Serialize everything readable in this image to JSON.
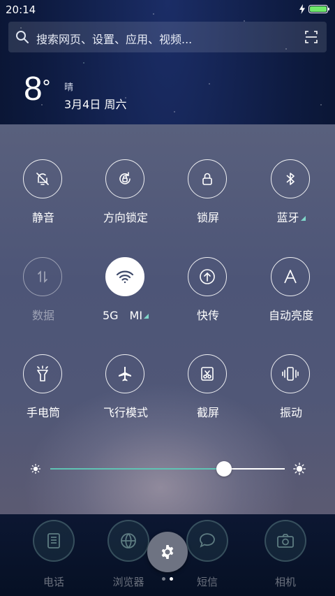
{
  "status_bar": {
    "time": "20:14",
    "battery_color": "#6fe86a"
  },
  "search": {
    "placeholder": "搜索网页、设置、应用、视频..."
  },
  "weather": {
    "temperature": "8",
    "unit": "°",
    "condition": "晴",
    "date": "3月4日 周六"
  },
  "quick_settings": {
    "accent_color": "#5fc3b4",
    "rows": [
      [
        {
          "label": "静音",
          "icon": "bell-off-icon",
          "state": "off"
        },
        {
          "label": "方向锁定",
          "icon": "rotation-lock-icon",
          "state": "off"
        },
        {
          "label": "锁屏",
          "icon": "lock-icon",
          "state": "off"
        },
        {
          "label": "蓝牙",
          "icon": "bluetooth-icon",
          "state": "off",
          "has_menu": true
        }
      ],
      [
        {
          "label": "数据",
          "icon": "mobile-data-icon",
          "state": "disabled"
        },
        {
          "label": "5G　MI",
          "icon": "wifi-icon",
          "state": "on",
          "has_menu": true
        },
        {
          "label": "快传",
          "icon": "share-upload-icon",
          "state": "off"
        },
        {
          "label": "自动亮度",
          "icon": "auto-brightness-icon",
          "state": "off"
        }
      ],
      [
        {
          "label": "手电筒",
          "icon": "flashlight-icon",
          "state": "off"
        },
        {
          "label": "飞行模式",
          "icon": "airplane-icon",
          "state": "off"
        },
        {
          "label": "截屏",
          "icon": "screenshot-icon",
          "state": "off"
        },
        {
          "label": "振动",
          "icon": "vibrate-icon",
          "state": "off"
        }
      ]
    ]
  },
  "brightness": {
    "level_percent": 74,
    "low_icon": "sun-small-icon",
    "high_icon": "sun-large-icon"
  },
  "dock": {
    "apps": [
      {
        "label": "电话",
        "icon": "phone-icon"
      },
      {
        "label": "浏览器",
        "icon": "globe-icon"
      },
      {
        "label": "短信",
        "icon": "message-icon"
      },
      {
        "label": "相机",
        "icon": "camera-icon"
      }
    ],
    "settings_icon": "gear-icon",
    "pages": 2,
    "current_page": 2
  }
}
